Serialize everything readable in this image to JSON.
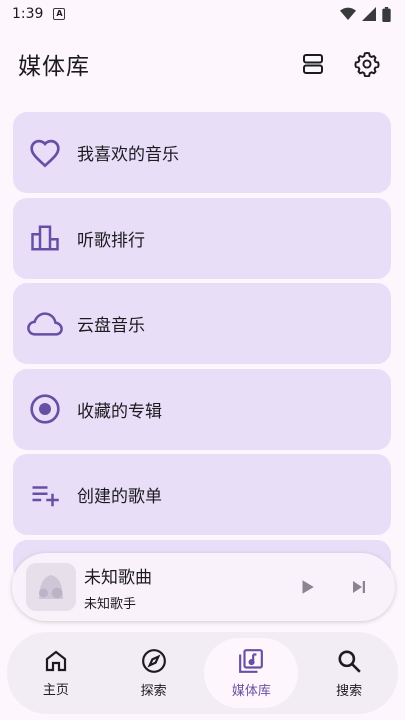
{
  "status_bar": {
    "time": "1:39",
    "notification_icon": "a-icon"
  },
  "app_bar": {
    "title": "媒体库"
  },
  "library_items": [
    {
      "label": "我喜欢的音乐",
      "icon": "heart"
    },
    {
      "label": "听歌排行",
      "icon": "bar-chart"
    },
    {
      "label": "云盘音乐",
      "icon": "cloud"
    },
    {
      "label": "收藏的专辑",
      "icon": "album"
    },
    {
      "label": "创建的歌单",
      "icon": "playlist-add"
    }
  ],
  "mini_player": {
    "title": "未知歌曲",
    "artist": "未知歌手"
  },
  "bottom_nav": [
    {
      "label": "主页",
      "icon": "home",
      "active": false
    },
    {
      "label": "探索",
      "icon": "compass",
      "active": false
    },
    {
      "label": "媒体库",
      "icon": "library-music",
      "active": true
    },
    {
      "label": "搜索",
      "icon": "search",
      "active": false
    }
  ],
  "colors": {
    "accent": "#6750a4",
    "card": "#e8def8",
    "background": "#fdf7fd"
  }
}
